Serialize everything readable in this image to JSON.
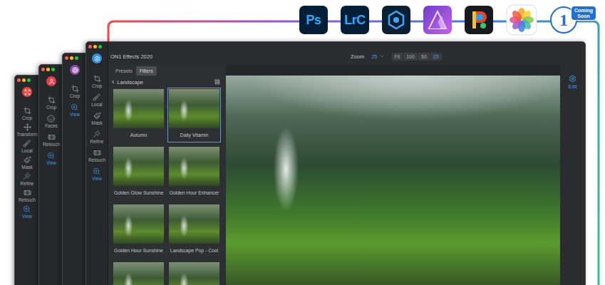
{
  "apps": [
    {
      "kind": "photoshop",
      "label": "Ps"
    },
    {
      "kind": "lightroom",
      "label": "LrC"
    },
    {
      "kind": "elements"
    },
    {
      "kind": "affinity"
    },
    {
      "kind": "paintshop"
    },
    {
      "kind": "photos"
    },
    {
      "kind": "on1",
      "label": "1",
      "badge": "Coming Soon"
    }
  ],
  "back_windows": [
    {
      "kind": "resize",
      "color": "#e8453c",
      "tools": [
        {
          "label": "Crop",
          "kind": "crop",
          "selected": false
        },
        {
          "label": "Transform",
          "kind": "transform",
          "selected": false
        },
        {
          "label": "Local",
          "kind": "local",
          "selected": false
        },
        {
          "label": "Mask",
          "kind": "mask",
          "selected": false
        },
        {
          "label": "Refine",
          "kind": "refine",
          "selected": false
        },
        {
          "label": "Retouch",
          "kind": "retouch",
          "selected": false
        },
        {
          "label": "View",
          "kind": "view",
          "selected": true
        }
      ]
    },
    {
      "kind": "portrait",
      "color": "#e2404a",
      "tools": [
        {
          "label": "Crop",
          "kind": "crop",
          "selected": false
        },
        {
          "label": "Faces",
          "kind": "faces",
          "selected": false
        },
        {
          "label": "Retouch",
          "kind": "retouch",
          "selected": false
        },
        {
          "label": "View",
          "kind": "view",
          "selected": true
        }
      ]
    },
    {
      "kind": "raw",
      "color": "#8e44ad",
      "tools": [
        {
          "label": "Crop",
          "kind": "crop",
          "selected": false
        },
        {
          "label": "View",
          "kind": "view",
          "selected": true
        }
      ]
    }
  ],
  "main_window": {
    "title": "ON1 Effects 2020",
    "kind": "effects",
    "color": "#2f8fe0",
    "tools": [
      {
        "label": "Crop",
        "kind": "crop",
        "selected": false
      },
      {
        "label": "Local",
        "kind": "local",
        "selected": false
      },
      {
        "label": "Mask",
        "kind": "mask",
        "selected": false
      },
      {
        "label": "Refine",
        "kind": "refine",
        "selected": false
      },
      {
        "label": "Retouch",
        "kind": "retouch",
        "selected": false
      },
      {
        "label": "View",
        "kind": "view",
        "selected": true
      }
    ],
    "zoom": {
      "label": "Zoom",
      "value": "25",
      "options": [
        {
          "label": "Fit",
          "selected": false
        },
        {
          "label": "100",
          "selected": false
        },
        {
          "label": "50",
          "selected": false
        },
        {
          "label": "25",
          "selected": true
        }
      ]
    },
    "tabs": [
      {
        "label": "Presets",
        "selected": false
      },
      {
        "label": "Filters",
        "selected": true
      }
    ],
    "category": {
      "back": "‹",
      "label": "Landscape"
    },
    "presets": [
      {
        "label": "Autumn",
        "selected": false
      },
      {
        "label": "Daily Vitamin",
        "selected": true
      },
      {
        "label": "Golden Glow Sunshine",
        "selected": false
      },
      {
        "label": "Golden Hour Enhancer",
        "selected": false
      },
      {
        "label": "Golden Hour Sunshine",
        "selected": false
      },
      {
        "label": "Landscape Pop - Cool",
        "selected": false
      },
      {
        "selected": false
      },
      {
        "selected": false
      }
    ],
    "edit_button": {
      "label": "Edit",
      "selected": true
    }
  }
}
